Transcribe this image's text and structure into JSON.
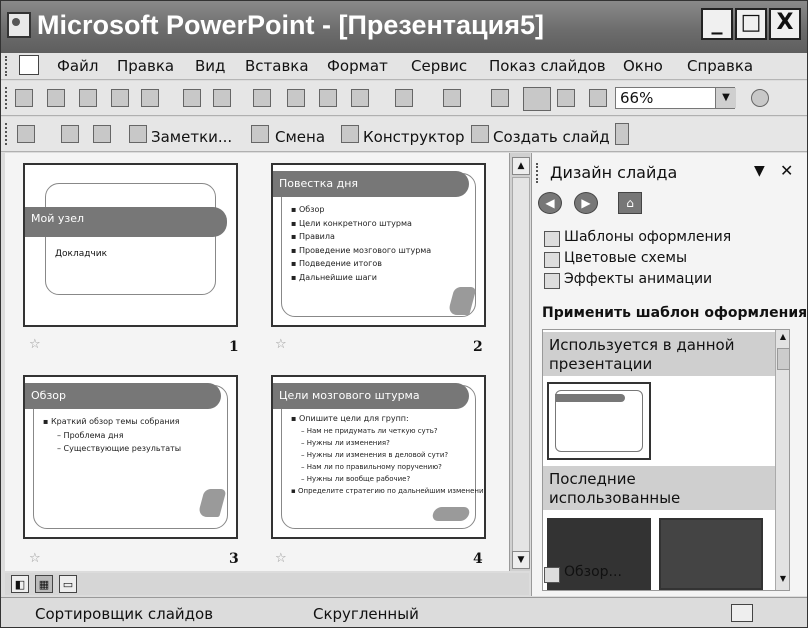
{
  "window": {
    "title": "Microsoft PowerPoint - [Презентация5]",
    "controls": {
      "minimize": "_",
      "maximize": "□",
      "close": "X"
    }
  },
  "menu": [
    "Файл",
    "Правка",
    "Вид",
    "Вставка",
    "Формат",
    "Сервис",
    "Показ слайдов",
    "Окно",
    "Справка"
  ],
  "toolbar": {
    "zoom_value": "66%",
    "buttons": [
      {
        "icon": "notes-icon",
        "label": "Заметки..."
      },
      {
        "icon": "transition-icon",
        "label": "Смена"
      },
      {
        "icon": "designer-icon",
        "label": "Конструктор"
      },
      {
        "icon": "new-slide-icon",
        "label": "Создать слайд"
      }
    ]
  },
  "slides": [
    {
      "number": "1",
      "title": "Мой узел",
      "subtitle": "Докладчик"
    },
    {
      "number": "2",
      "title": "Повестка дня",
      "bullets": [
        "Обзор",
        "Цели конкретного штурма",
        "Правила",
        "Проведение мозгового штурма",
        "Подведение итогов",
        "Дальнейшие шаги"
      ]
    },
    {
      "number": "3",
      "title": "Обзор",
      "bullets": [
        "Краткий обзор темы собрания",
        "Проблема дня",
        "Существующие результаты"
      ]
    },
    {
      "number": "4",
      "title": "Цели мозгового штурма",
      "bullets": [
        "Опишите цели для групп:",
        "Нам не придумать ли четкую суть?",
        "Нужны ли изменения?",
        "Нужны ли изменения в деловой сути?",
        "Нам ли по правильному поручению?",
        "Нужны ли вообще рабочие?",
        "Определите стратегию по дальнейшим изменениям"
      ]
    }
  ],
  "task_pane": {
    "title": "Дизайн слайда",
    "links": [
      "Шаблоны оформления",
      "Цветовые схемы",
      "Эффекты анимации"
    ],
    "apply_label": "Применить шаблон оформления:",
    "section_used": "Используется в данной презентации",
    "section_recent": "Последние использованные",
    "browse": "Обзор..."
  },
  "status": {
    "view": "Сортировщик слайдов",
    "design": "Скругленный"
  }
}
